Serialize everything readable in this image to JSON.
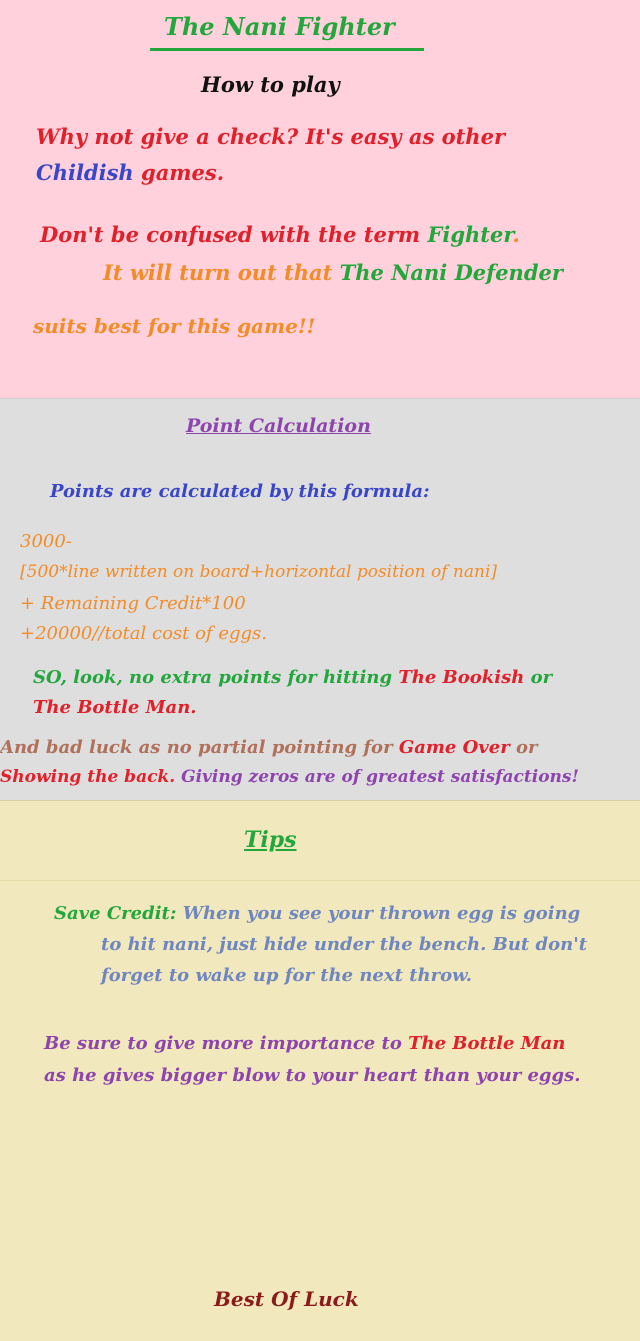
{
  "title": "The Nani Fighter",
  "how_to_play": {
    "heading": "How to play",
    "p1a": "Why not give a check? It's easy as other",
    "p1b": "Childish",
    "p1c": "games.",
    "p2a": "Don't be confused with the term",
    "p2b": "Fighter",
    "p2c": ".",
    "p3a": "It will turn out that",
    "p3b": "The Nani Defender",
    "p4": "suits best for this game!!"
  },
  "points": {
    "heading": "Point Calculation",
    "intro": "Points are calculated by this formula:",
    "f1": "3000-",
    "f2": "[500*line written on board+horizontal position of nani]",
    "f3": "+ Remaining Credit*100",
    "f4": "+20000//total cost of eggs.",
    "n1a": "SO, look, no extra points for hitting",
    "n1b": "The Bookish",
    "n1c": "or",
    "n2": "The Bottle Man.",
    "b1a": "And bad luck as no partial pointing for",
    "b1b": "Game Over",
    "b1c": "or",
    "b2a": "Showing the back.",
    "b2b": "Giving zeros are of greatest satisfactions!"
  },
  "tips": {
    "heading": "Tips",
    "save_label": "Save Credit:",
    "save1": "When you see your thrown egg is going",
    "save2": "to hit nani, just hide under the bench. But don't",
    "save3": "forget to wake up for the next throw.",
    "bm1a": "Be sure to give more importance to",
    "bm1b": "The Bottle Man",
    "bm2": "as he gives bigger blow to your heart than your eggs."
  },
  "footer": "Best Of Luck",
  "colors": {
    "pink": "#ffd1dc",
    "gray": "#dedede",
    "cream": "#f1e9bd",
    "red": "#e0202a",
    "blue": "#3a46c8",
    "green": "#23a63c",
    "orange": "#f28c28",
    "purple": "#8e44ad",
    "brown": "#b0705a",
    "steel": "#6f86bf",
    "maroon": "#8b1a1a"
  }
}
